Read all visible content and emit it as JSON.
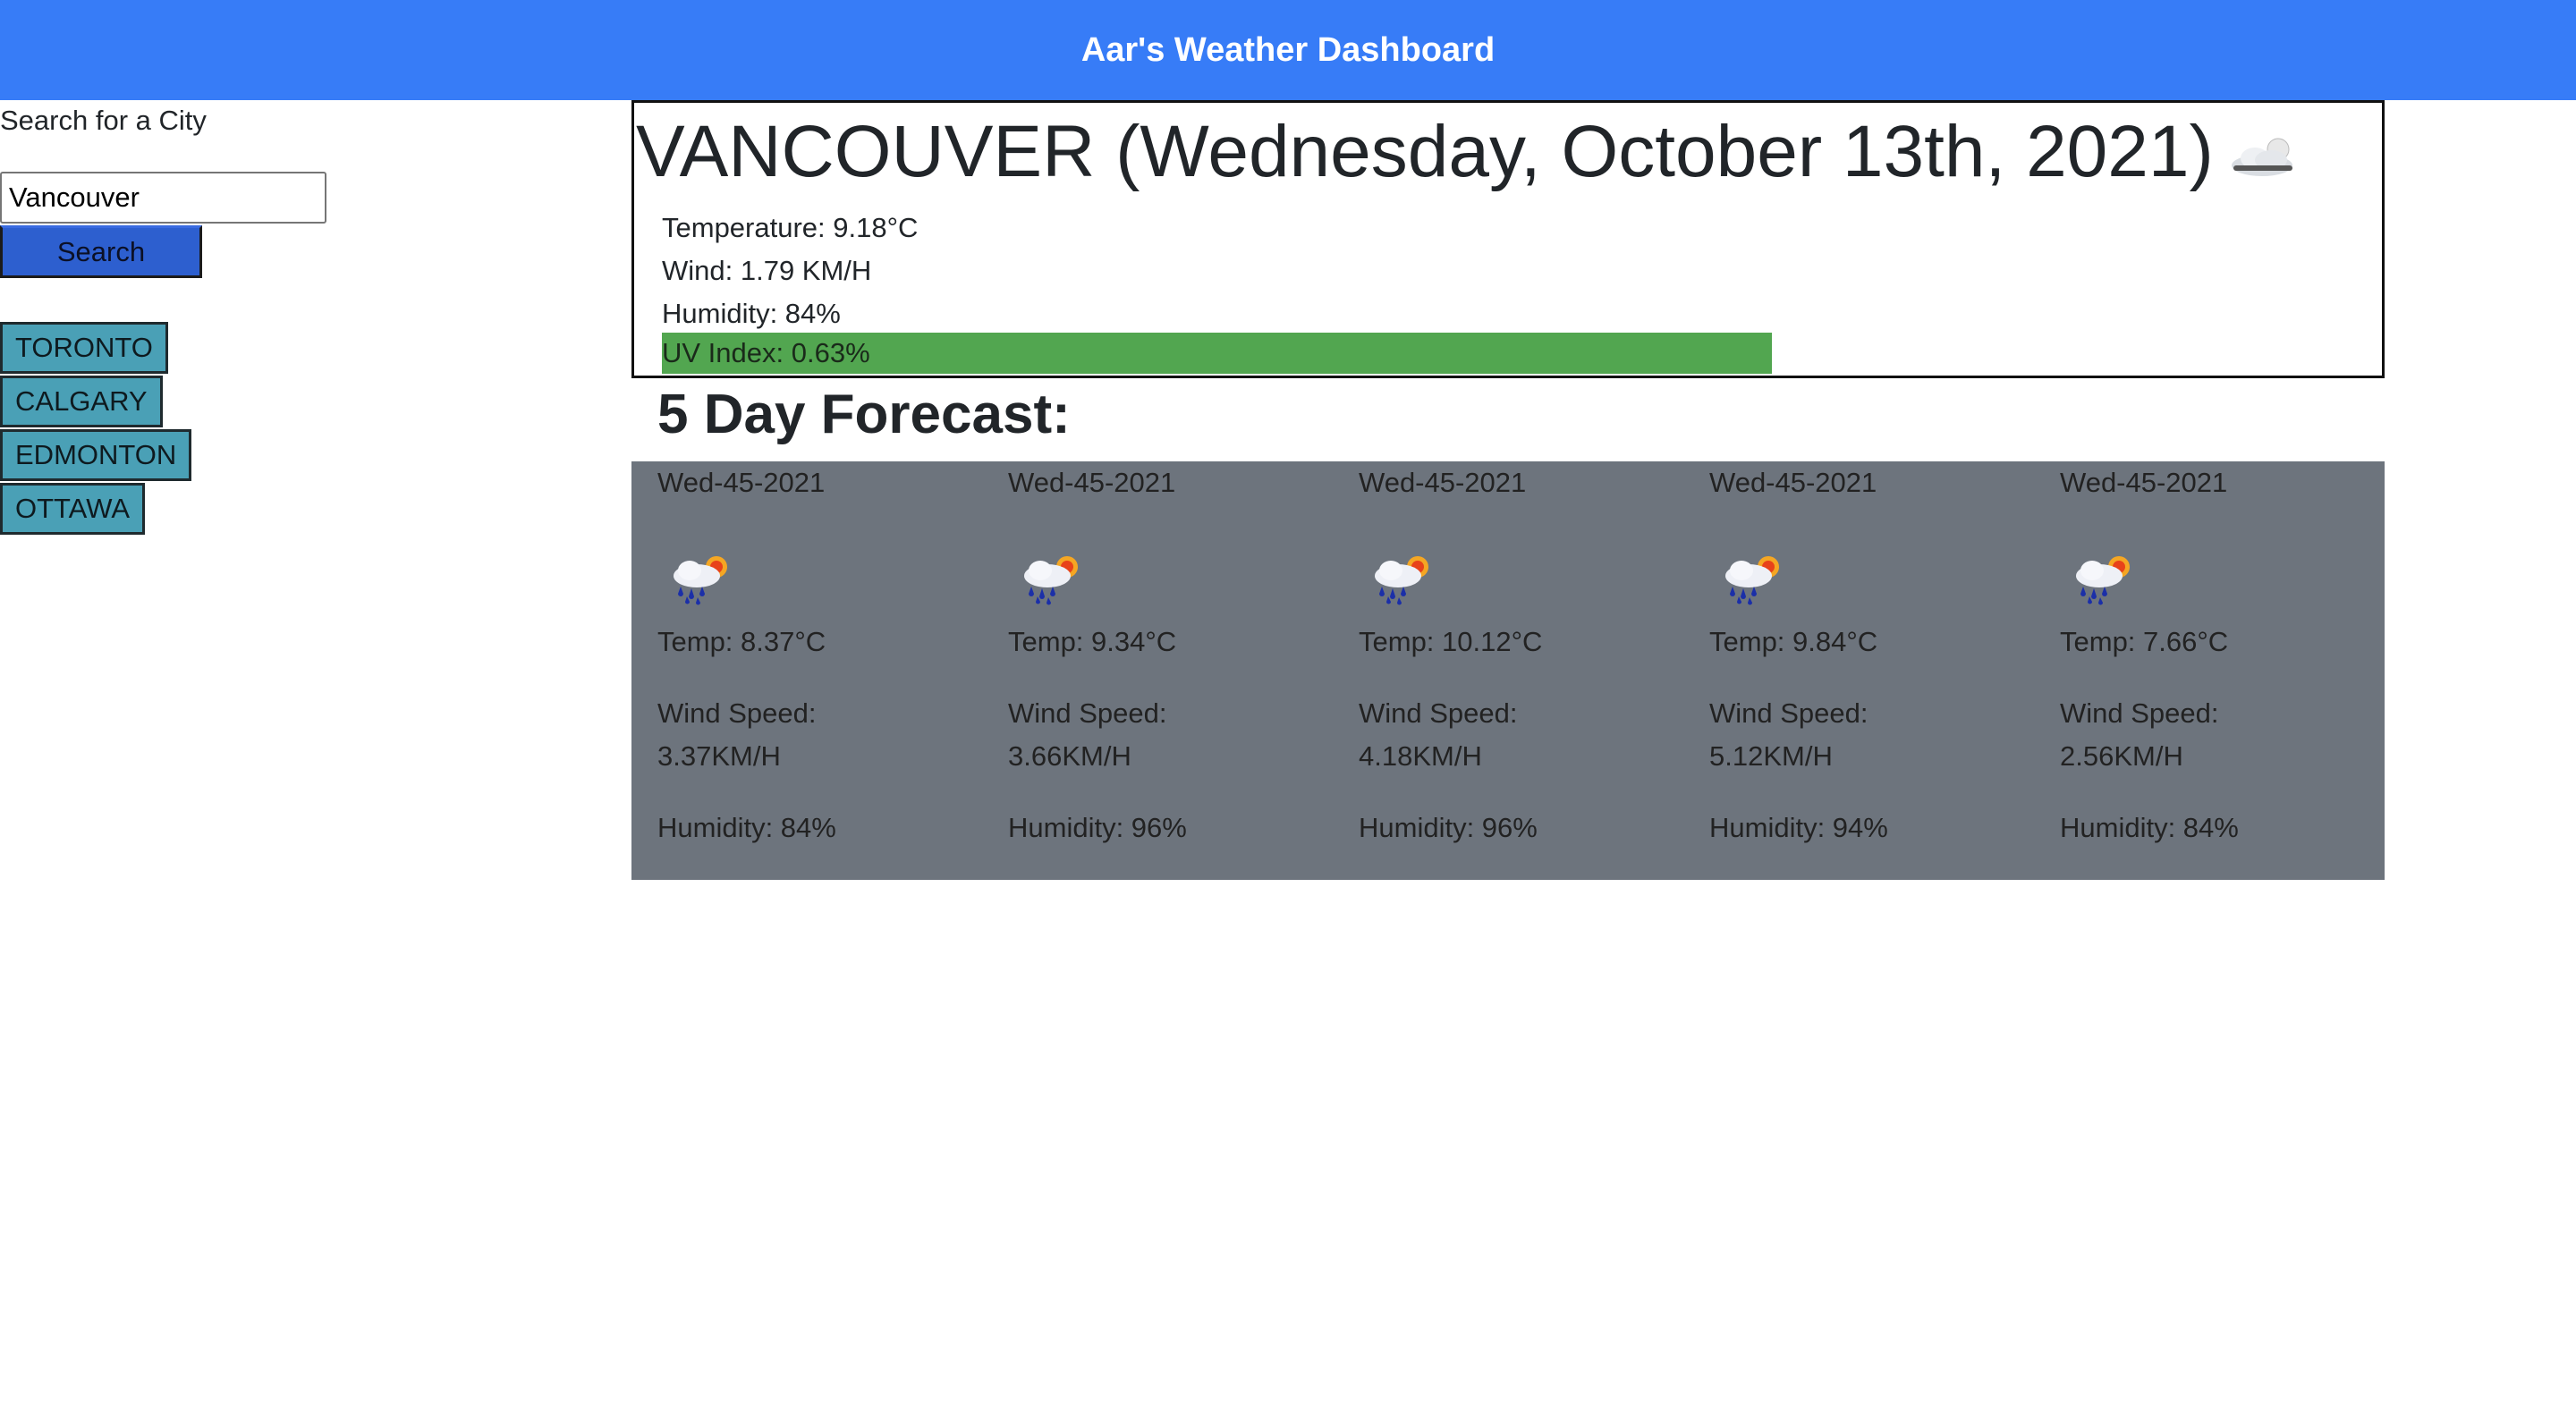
{
  "header": {
    "title": "Aar's Weather Dashboard"
  },
  "colors": {
    "header": "#377cf7",
    "search_button": "#2d5fcf",
    "history_button": "#4aa0b6",
    "uv_bar": "#52a650",
    "forecast_panel": "#6d747d"
  },
  "search": {
    "label": "Search for a City",
    "input_value": "Vancouver",
    "button_label": "Search"
  },
  "history": [
    "TORONTO",
    "CALGARY",
    "EDMONTON",
    "OTTAWA"
  ],
  "current": {
    "title": "VANCOUVER (Wednesday, October 13th, 2021)",
    "icon": "cloud-with-sun-icon",
    "temperature": "Temperature: 9.18°C",
    "wind": "Wind: 1.79 KM/H",
    "humidity": "Humidity: 84%",
    "uv_index": "UV Index: 0.63%"
  },
  "forecast": {
    "heading": "5 Day Forecast:",
    "days": [
      {
        "date": "Wed-45-2021",
        "icon": "rain-sun-icon",
        "temp": "Temp: 8.37°C",
        "wind_label": "Wind Speed:",
        "wind_value": "3.37KM/H",
        "humidity": "Humidity: 84%"
      },
      {
        "date": "Wed-45-2021",
        "icon": "rain-sun-icon",
        "temp": "Temp: 9.34°C",
        "wind_label": "Wind Speed:",
        "wind_value": "3.66KM/H",
        "humidity": "Humidity: 96%"
      },
      {
        "date": "Wed-45-2021",
        "icon": "rain-sun-icon",
        "temp": "Temp: 10.12°C",
        "wind_label": "Wind Speed:",
        "wind_value": "4.18KM/H",
        "humidity": "Humidity: 96%"
      },
      {
        "date": "Wed-45-2021",
        "icon": "rain-sun-icon",
        "temp": "Temp: 9.84°C",
        "wind_label": "Wind Speed:",
        "wind_value": "5.12KM/H",
        "humidity": "Humidity: 94%"
      },
      {
        "date": "Wed-45-2021",
        "icon": "rain-sun-icon",
        "temp": "Temp: 7.66°C",
        "wind_label": "Wind Speed:",
        "wind_value": "2.56KM/H",
        "humidity": "Humidity: 84%"
      }
    ]
  }
}
